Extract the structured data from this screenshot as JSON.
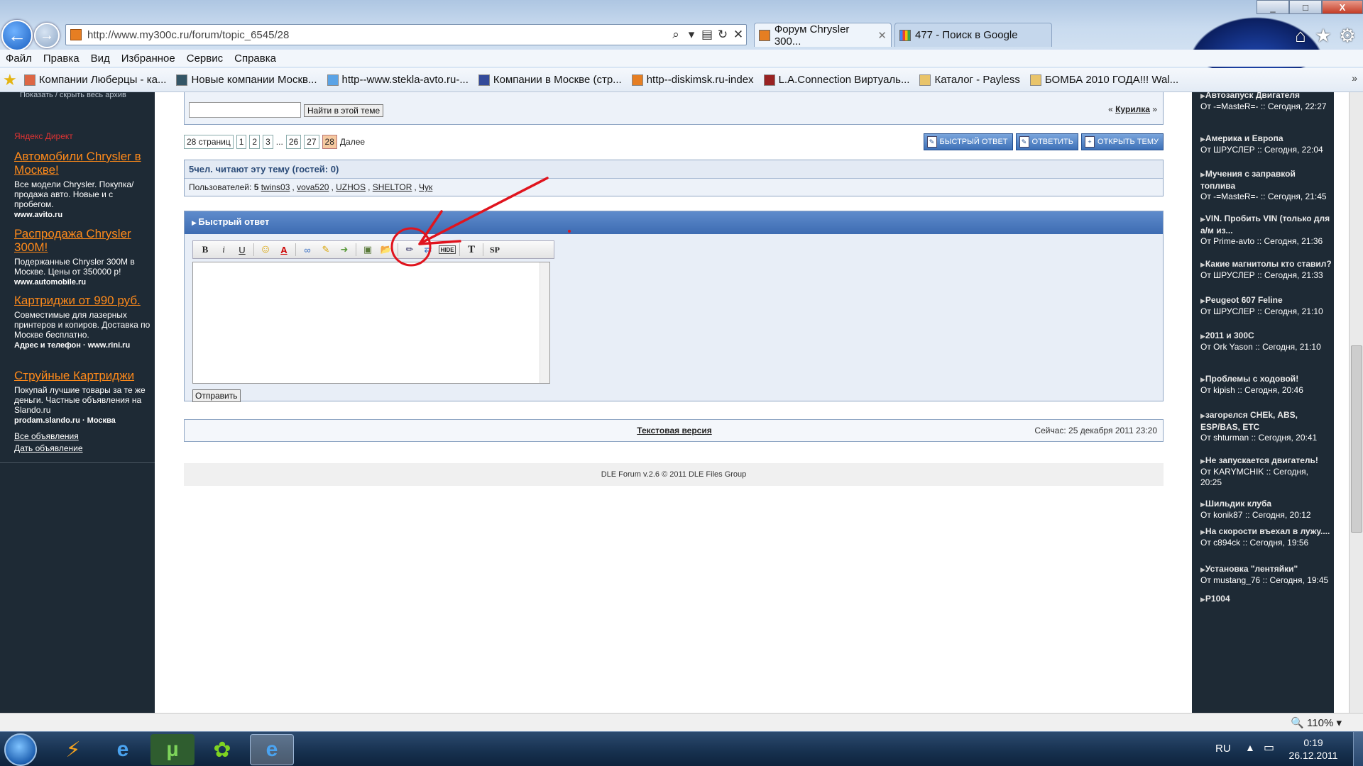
{
  "window": {
    "minimize": "_",
    "maximize": "□",
    "close": "X"
  },
  "nav": {
    "back": "←",
    "forward": "→",
    "url": "http://www.my300c.ru/forum/topic_6545/28",
    "search_icon": "⌕",
    "dropdown_icon": "▾",
    "compat_icon": "▤",
    "refresh_icon": "↻",
    "stop_icon": "✕"
  },
  "tabs": [
    {
      "title": "Форум Chrysler 300...",
      "close": "✕"
    },
    {
      "title": "477 - Поиск в Google",
      "close": ""
    }
  ],
  "command_icons": {
    "home": "⌂",
    "favorites": "★",
    "tools": "⚙"
  },
  "menu": [
    "Файл",
    "Правка",
    "Вид",
    "Избранное",
    "Сервис",
    "Справка"
  ],
  "favorites_bar": {
    "items": [
      "Компании Люберцы - ка...",
      "Новые компании Москв...",
      "http--www.stekla-avto.ru-...",
      "Компании в Москве (стр...",
      "http--diskimsk.ru-index",
      "L.A.Connection Виртуаль...",
      "Каталог - Payless",
      "БОМБА 2010 ГОДА!!! Wal..."
    ],
    "more": "»"
  },
  "left_sidebar": {
    "archive_link": "Показать / скрыть весь архив",
    "yandex_direct": "Яндекс  Директ",
    "ads": [
      {
        "title": "Автомобили Chrysler в Москве!",
        "text": "Все модели Chrysler. Покупка/продажа авто. Новые и с пробегом.",
        "url": "www.avito.ru"
      },
      {
        "title": "Распродажа Chrysler 300M!",
        "text": "Подержанные Chrysler 300M в Москве. Цены от 350000 р!",
        "url": "www.automobile.ru"
      },
      {
        "title": "Картриджи от 990 руб.",
        "text": "Совместимые для лазерных принтеров и копиров. Доставка по Москве бесплатно.",
        "url": "Адрес и телефон  ·  www.rini.ru"
      },
      {
        "title": "Струйные Картриджи",
        "text": "Покупай лучшие товары за те же деньги. Частные объявления на Slando.ru",
        "url": "prodam.slando.ru  ·  Москва"
      }
    ],
    "links": [
      "Все объявления",
      "Дать объявление"
    ]
  },
  "search": {
    "placeholder": "",
    "button": "Найти в этой теме"
  },
  "topic_nav": {
    "prev": "«",
    "section": "Курилка",
    "next": "»"
  },
  "pagination": {
    "label": "28 страниц",
    "pages": [
      "1",
      "2",
      "3"
    ],
    "ellipsis": "...",
    "pages_end": [
      "26",
      "27"
    ],
    "current": "28",
    "next": "Далее"
  },
  "actions": {
    "quick_reply": "Быстрый ответ",
    "reply": "Ответить",
    "new_topic": "Открыть тему"
  },
  "readers": {
    "header": "5чел. читают эту тему (гостей: 0)",
    "users_label": "Пользователей:",
    "users_count": "5",
    "users": [
      "twins03",
      "vova520",
      "UZHOS",
      "SHELTOR",
      "Чук"
    ]
  },
  "quick_reply": {
    "header": "Быстрый ответ",
    "toolbar": {
      "bold": "B",
      "italic": "i",
      "underline": "U",
      "smile": "☺",
      "color": "A",
      "link": "∞",
      "leech": "✎",
      "email": "➜",
      "image": "▣",
      "upload": "📂",
      "edit": "✏",
      "translit": "⇄",
      "hide": "HIDE",
      "font": "T",
      "spoiler": "SP"
    },
    "submit": "Отправить"
  },
  "footer": {
    "text_version": "Текстовая версия",
    "now": "Сейчас: 25 декабря 2011 23:20",
    "copyright": "DLE Forum v.2.6 © 2011 DLE Files Group"
  },
  "right_sidebar": {
    "items": [
      {
        "title": "Автозапуск Двигателя",
        "meta": "От -=MasteR=- :: Сегодня, 22:27"
      },
      {
        "title": "Америка и Европа",
        "meta": "От ШРУСЛЕР :: Сегодня, 22:04"
      },
      {
        "title": "Мучения с заправкой топлива",
        "meta": "От -=MasteR=- :: Сегодня, 21:45"
      },
      {
        "title": "VIN. Пробить VIN (только для а/м из...",
        "meta": "От Prime-avto :: Сегодня, 21:36"
      },
      {
        "title": "Какие магнитолы кто ставил?",
        "meta": "От ШРУСЛЕР :: Сегодня, 21:33"
      },
      {
        "title": "Peugeot 607 Feline",
        "meta": "От ШРУСЛЕР :: Сегодня, 21:10"
      },
      {
        "title": "2011 и 300С",
        "meta": "От Ork Yason :: Сегодня, 21:10"
      },
      {
        "title": "Проблемы с ходовой!",
        "meta": "От kipish :: Сегодня, 20:46"
      },
      {
        "title": "загорелся CHEk, ABS, ESP/BAS, ETC",
        "meta": "От shturman :: Сегодня, 20:41"
      },
      {
        "title": "Не запускается двигатель!",
        "meta": "От KARYMCHIK :: Сегодня, 20:25"
      },
      {
        "title": "Шильдик клуба",
        "meta": "От konik87 :: Сегодня, 20:12"
      },
      {
        "title": "На скорости въехал в лужу....",
        "meta": "От c894ck :: Сегодня, 19:56"
      },
      {
        "title": "Установка \"лентяйки\"",
        "meta": "От mustang_76 :: Сегодня, 19:45"
      },
      {
        "title": "P1004",
        "meta": ""
      }
    ]
  },
  "statusbar": {
    "zoom": "110%",
    "zoom_dropdown": "▾"
  },
  "taskbar": {
    "lang": "RU",
    "tray_up": "▲",
    "time": "0:19",
    "date": "26.12.2011"
  },
  "colors": {
    "sidebar_bg": "#1e2a35",
    "ad_title": "#ff8a1a",
    "panel_header": "#3d6cb2",
    "annotation": "#e0141e"
  }
}
